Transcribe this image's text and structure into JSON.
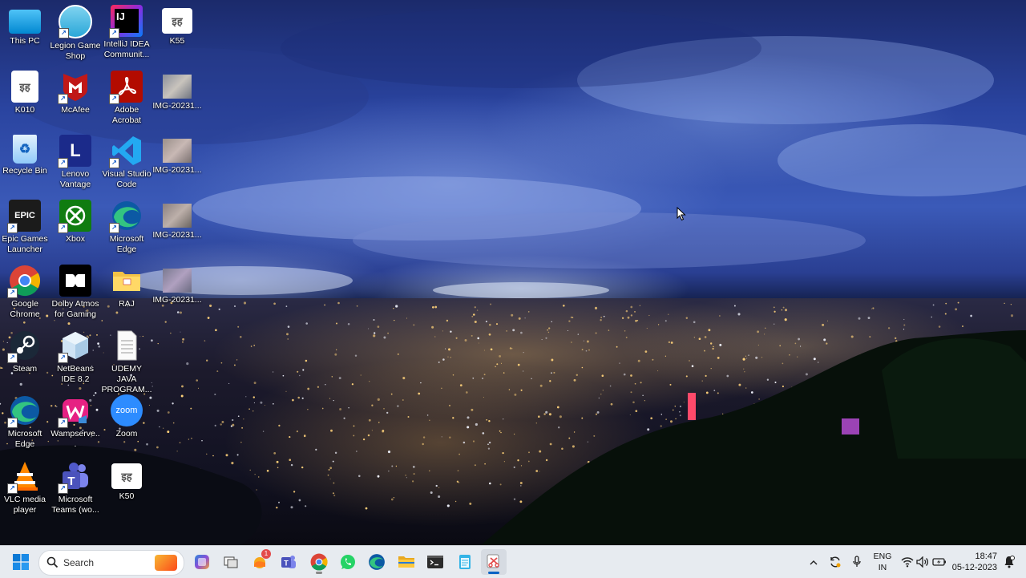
{
  "desktop": {
    "icons": [
      {
        "label": "This PC"
      },
      {
        "label": "Legion Game Shop"
      },
      {
        "label": "IntelliJ IDEA Communit..."
      },
      {
        "label": "K55"
      },
      {
        "label": "K010"
      },
      {
        "label": "McAfee"
      },
      {
        "label": "Adobe Acrobat"
      },
      {
        "label": "IMG-20231..."
      },
      {
        "label": "Recycle Bin"
      },
      {
        "label": "Lenovo Vantage"
      },
      {
        "label": "Visual Studio Code"
      },
      {
        "label": "IMG-20231..."
      },
      {
        "label": "Epic Games Launcher"
      },
      {
        "label": "Xbox"
      },
      {
        "label": "Microsoft Edge"
      },
      {
        "label": "IMG-20231..."
      },
      {
        "label": "Google Chrome"
      },
      {
        "label": "Dolby Atmos for Gaming"
      },
      {
        "label": "RAJ"
      },
      {
        "label": "IMG-20231..."
      },
      {
        "label": "Steam"
      },
      {
        "label": "NetBeans IDE 8.2"
      },
      {
        "label": "UDEMY JAVA PROGRAM..."
      },
      {
        "label": "Microsoft Edge"
      },
      {
        "label": "Wampserve..."
      },
      {
        "label": "Zoom"
      },
      {
        "label": "VLC media player"
      },
      {
        "label": "Microsoft Teams (wo..."
      },
      {
        "label": "K50"
      }
    ],
    "glyphs": {
      "ij": "IJ",
      "k_file": "इह",
      "lenovo": "L",
      "epic": "EPIC",
      "zoom": "zoom"
    }
  },
  "taskbar": {
    "search_placeholder": "Search",
    "notification_count": "1",
    "language": "ENG",
    "region": "IN",
    "time": "18:47",
    "date": "05-12-2023"
  }
}
